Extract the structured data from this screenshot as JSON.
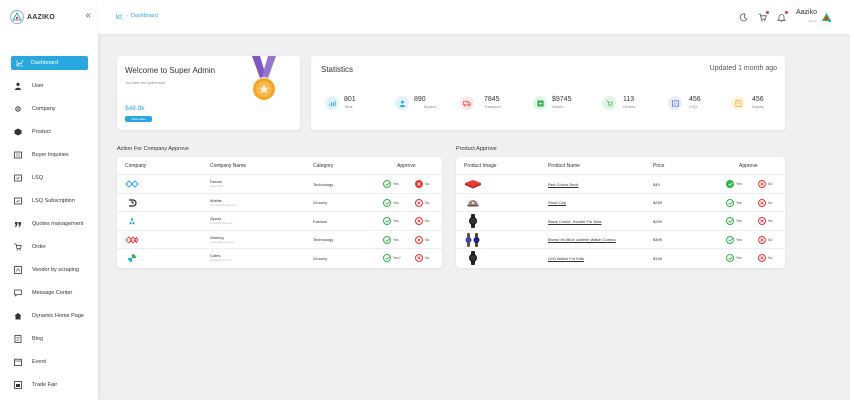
{
  "brand": {
    "name": "AAZIKO",
    "collapse_icon": "«"
  },
  "sidebar": {
    "items": [
      {
        "label": "Dashboard",
        "icon": "chart-icon"
      },
      {
        "label": "User",
        "icon": "user-icon"
      },
      {
        "label": "Company",
        "icon": "company-icon"
      },
      {
        "label": "Product",
        "icon": "product-icon"
      },
      {
        "label": "Buyer Inquiries",
        "icon": "inquiry-icon"
      },
      {
        "label": "LSQ",
        "icon": "lsq-icon"
      },
      {
        "label": "LSQ Subscription",
        "icon": "subscription-icon"
      },
      {
        "label": "Quotes management",
        "icon": "quote-icon"
      },
      {
        "label": "Order",
        "icon": "cart-icon"
      },
      {
        "label": "Vendor by scraping",
        "icon": "scrape-icon"
      },
      {
        "label": "Message Center",
        "icon": "message-icon"
      },
      {
        "label": "Dynamic Home Page",
        "icon": "home-icon"
      },
      {
        "label": "Blog",
        "icon": "blog-icon"
      },
      {
        "label": "Event",
        "icon": "event-icon"
      },
      {
        "label": "Trade Fair",
        "icon": "trade-fair-icon"
      }
    ]
  },
  "topbar": {
    "breadcrumb": "Dashboard",
    "user_name": "Aaziko",
    "user_role": "admin"
  },
  "welcome": {
    "title": "Welcome to Super Admin",
    "subtitle": "You have won gold medal",
    "amount": "$48.9k",
    "button": "View sales"
  },
  "stats": {
    "title": "Statistics",
    "updated": "Updated 1 month ago",
    "items": [
      {
        "value": "801",
        "label": "Total",
        "color": "#29a8e0",
        "icon": "chart-icon"
      },
      {
        "value": "890",
        "label": "Buyers",
        "color": "#29a8e0",
        "icon": "user-icon"
      },
      {
        "value": "7845",
        "label": "Transport",
        "color": "#e53935",
        "icon": "truck-icon"
      },
      {
        "value": "$9745",
        "label": "Admin",
        "color": "#2eb24a",
        "icon": "admin-icon"
      },
      {
        "value": "113",
        "label": "Orders",
        "color": "#2eb24a",
        "icon": "cart-icon"
      },
      {
        "value": "456",
        "label": "LSQ",
        "color": "#5c6bc0",
        "icon": "lsq-icon"
      },
      {
        "value": "456",
        "label": "Inquiry",
        "color": "#f5a623",
        "icon": "inquiry-icon"
      }
    ]
  },
  "company_section": {
    "title": "Action For Company Approve",
    "headers": {
      "company": "Company",
      "name": "Company Name",
      "category": "Category",
      "approve": "Approve"
    },
    "rows": [
      {
        "name": "Dream",
        "sub": "diag-2019",
        "category": "Technology",
        "yes": "Yes",
        "no": "No",
        "no_filled": true,
        "logo_color": "#29a8e0"
      },
      {
        "name": "Mobile",
        "sub": "mmobile@mail.com",
        "category": "Grocery",
        "yes": "Yes",
        "no": "No",
        "no_filled": false,
        "logo_color": "#222"
      },
      {
        "name": "Zipcar",
        "sub": "zipcar@mail.com",
        "category": "Fashion",
        "yes": "Yes",
        "no": "No",
        "no_filled": false,
        "logo_color": "#29a8e0"
      },
      {
        "name": "Owning",
        "sub": "owning@mail.com",
        "category": "Technology",
        "yes": "Yes",
        "no": "No",
        "no_filled": false,
        "logo_color": "#e53935"
      },
      {
        "name": "Cafes",
        "sub": "cafes@mail.com",
        "category": "Grocery",
        "yes": "Yes?",
        "no": "No",
        "no_filled": false,
        "logo_color": "#2eb24a"
      }
    ]
  },
  "product_section": {
    "title": "Product Approve",
    "headers": {
      "image": "Product Image",
      "name": "Product Name",
      "price": "Price",
      "approve": "Approve"
    },
    "rows": [
      {
        "name": "Red Colour Book",
        "price": "$49",
        "yes": "Yes",
        "no": "No",
        "yes_filled": true,
        "img": "book"
      },
      {
        "name": "Short Cap",
        "price": "$299",
        "yes": "Yes",
        "no": "No",
        "yes_filled": false,
        "img": "cap"
      },
      {
        "name": "Black Colour, Hoodie For Kids",
        "price": "$249",
        "yes": "Yes",
        "no": "No",
        "yes_filled": false,
        "img": "watch-black"
      },
      {
        "name": "Brown Hd Blue Leather Watch Combo",
        "price": "$499",
        "yes": "Yes",
        "no": "No",
        "yes_filled": false,
        "img": "watch-combo"
      },
      {
        "name": "LED Watch For Kids",
        "price": "$149",
        "yes": "Yes",
        "no": "No",
        "yes_filled": false,
        "img": "watch-black"
      }
    ]
  }
}
